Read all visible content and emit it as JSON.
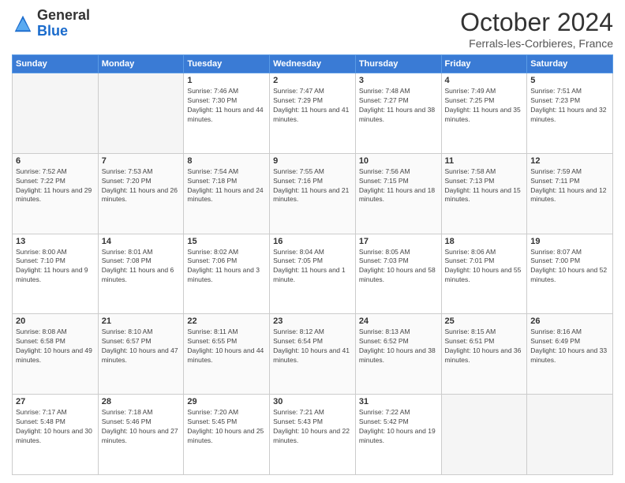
{
  "header": {
    "logo_general": "General",
    "logo_blue": "Blue",
    "month": "October 2024",
    "location": "Ferrals-les-Corbieres, France"
  },
  "weekdays": [
    "Sunday",
    "Monday",
    "Tuesday",
    "Wednesday",
    "Thursday",
    "Friday",
    "Saturday"
  ],
  "weeks": [
    [
      {
        "day": "",
        "empty": true
      },
      {
        "day": "",
        "empty": true
      },
      {
        "day": "1",
        "sunrise": "7:46 AM",
        "sunset": "7:30 PM",
        "daylight": "11 hours and 44 minutes."
      },
      {
        "day": "2",
        "sunrise": "7:47 AM",
        "sunset": "7:29 PM",
        "daylight": "11 hours and 41 minutes."
      },
      {
        "day": "3",
        "sunrise": "7:48 AM",
        "sunset": "7:27 PM",
        "daylight": "11 hours and 38 minutes."
      },
      {
        "day": "4",
        "sunrise": "7:49 AM",
        "sunset": "7:25 PM",
        "daylight": "11 hours and 35 minutes."
      },
      {
        "day": "5",
        "sunrise": "7:51 AM",
        "sunset": "7:23 PM",
        "daylight": "11 hours and 32 minutes."
      }
    ],
    [
      {
        "day": "6",
        "sunrise": "7:52 AM",
        "sunset": "7:22 PM",
        "daylight": "11 hours and 29 minutes."
      },
      {
        "day": "7",
        "sunrise": "7:53 AM",
        "sunset": "7:20 PM",
        "daylight": "11 hours and 26 minutes."
      },
      {
        "day": "8",
        "sunrise": "7:54 AM",
        "sunset": "7:18 PM",
        "daylight": "11 hours and 24 minutes."
      },
      {
        "day": "9",
        "sunrise": "7:55 AM",
        "sunset": "7:16 PM",
        "daylight": "11 hours and 21 minutes."
      },
      {
        "day": "10",
        "sunrise": "7:56 AM",
        "sunset": "7:15 PM",
        "daylight": "11 hours and 18 minutes."
      },
      {
        "day": "11",
        "sunrise": "7:58 AM",
        "sunset": "7:13 PM",
        "daylight": "11 hours and 15 minutes."
      },
      {
        "day": "12",
        "sunrise": "7:59 AM",
        "sunset": "7:11 PM",
        "daylight": "11 hours and 12 minutes."
      }
    ],
    [
      {
        "day": "13",
        "sunrise": "8:00 AM",
        "sunset": "7:10 PM",
        "daylight": "11 hours and 9 minutes."
      },
      {
        "day": "14",
        "sunrise": "8:01 AM",
        "sunset": "7:08 PM",
        "daylight": "11 hours and 6 minutes."
      },
      {
        "day": "15",
        "sunrise": "8:02 AM",
        "sunset": "7:06 PM",
        "daylight": "11 hours and 3 minutes."
      },
      {
        "day": "16",
        "sunrise": "8:04 AM",
        "sunset": "7:05 PM",
        "daylight": "11 hours and 1 minute."
      },
      {
        "day": "17",
        "sunrise": "8:05 AM",
        "sunset": "7:03 PM",
        "daylight": "10 hours and 58 minutes."
      },
      {
        "day": "18",
        "sunrise": "8:06 AM",
        "sunset": "7:01 PM",
        "daylight": "10 hours and 55 minutes."
      },
      {
        "day": "19",
        "sunrise": "8:07 AM",
        "sunset": "7:00 PM",
        "daylight": "10 hours and 52 minutes."
      }
    ],
    [
      {
        "day": "20",
        "sunrise": "8:08 AM",
        "sunset": "6:58 PM",
        "daylight": "10 hours and 49 minutes."
      },
      {
        "day": "21",
        "sunrise": "8:10 AM",
        "sunset": "6:57 PM",
        "daylight": "10 hours and 47 minutes."
      },
      {
        "day": "22",
        "sunrise": "8:11 AM",
        "sunset": "6:55 PM",
        "daylight": "10 hours and 44 minutes."
      },
      {
        "day": "23",
        "sunrise": "8:12 AM",
        "sunset": "6:54 PM",
        "daylight": "10 hours and 41 minutes."
      },
      {
        "day": "24",
        "sunrise": "8:13 AM",
        "sunset": "6:52 PM",
        "daylight": "10 hours and 38 minutes."
      },
      {
        "day": "25",
        "sunrise": "8:15 AM",
        "sunset": "6:51 PM",
        "daylight": "10 hours and 36 minutes."
      },
      {
        "day": "26",
        "sunrise": "8:16 AM",
        "sunset": "6:49 PM",
        "daylight": "10 hours and 33 minutes."
      }
    ],
    [
      {
        "day": "27",
        "sunrise": "7:17 AM",
        "sunset": "5:48 PM",
        "daylight": "10 hours and 30 minutes."
      },
      {
        "day": "28",
        "sunrise": "7:18 AM",
        "sunset": "5:46 PM",
        "daylight": "10 hours and 27 minutes."
      },
      {
        "day": "29",
        "sunrise": "7:20 AM",
        "sunset": "5:45 PM",
        "daylight": "10 hours and 25 minutes."
      },
      {
        "day": "30",
        "sunrise": "7:21 AM",
        "sunset": "5:43 PM",
        "daylight": "10 hours and 22 minutes."
      },
      {
        "day": "31",
        "sunrise": "7:22 AM",
        "sunset": "5:42 PM",
        "daylight": "10 hours and 19 minutes."
      },
      {
        "day": "",
        "empty": true
      },
      {
        "day": "",
        "empty": true
      }
    ]
  ]
}
